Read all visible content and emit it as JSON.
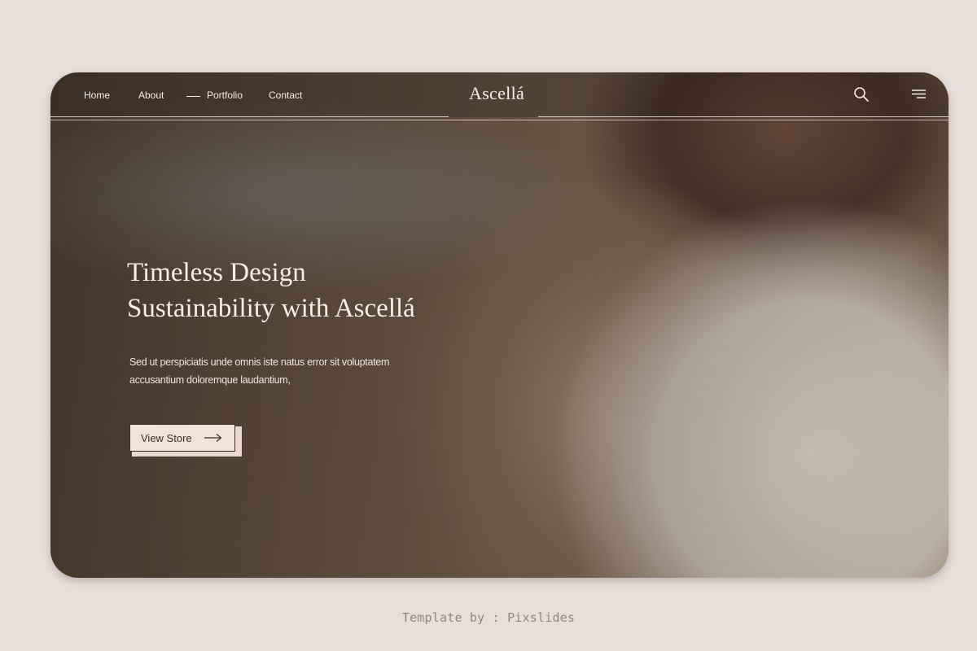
{
  "nav": {
    "items": [
      {
        "label": "Home"
      },
      {
        "label": "About"
      },
      {
        "label": "Portfolio"
      },
      {
        "label": "Contact"
      }
    ],
    "brand": "Ascellá",
    "icons": {
      "search": "search-icon",
      "menu": "hamburger-menu-icon",
      "active_marker": "dash-marker"
    }
  },
  "hero": {
    "title_line1": "Timeless Design",
    "title_line2": "Sustainability with Ascellá",
    "subtitle_line1": "Sed ut perspiciatis unde omnis iste natus error sit voluptatem",
    "subtitle_line2": "accusantium doloremque laudantium,",
    "cta_label": "View Store",
    "cta_icon": "arrow-right-icon"
  },
  "footer": {
    "credit": "Template by : Pixslides"
  },
  "colors": {
    "page_background": "#e8dfda",
    "button_background": "#f2e3d8",
    "button_border": "#3d2e25",
    "hero_text": "#f7efe8"
  }
}
